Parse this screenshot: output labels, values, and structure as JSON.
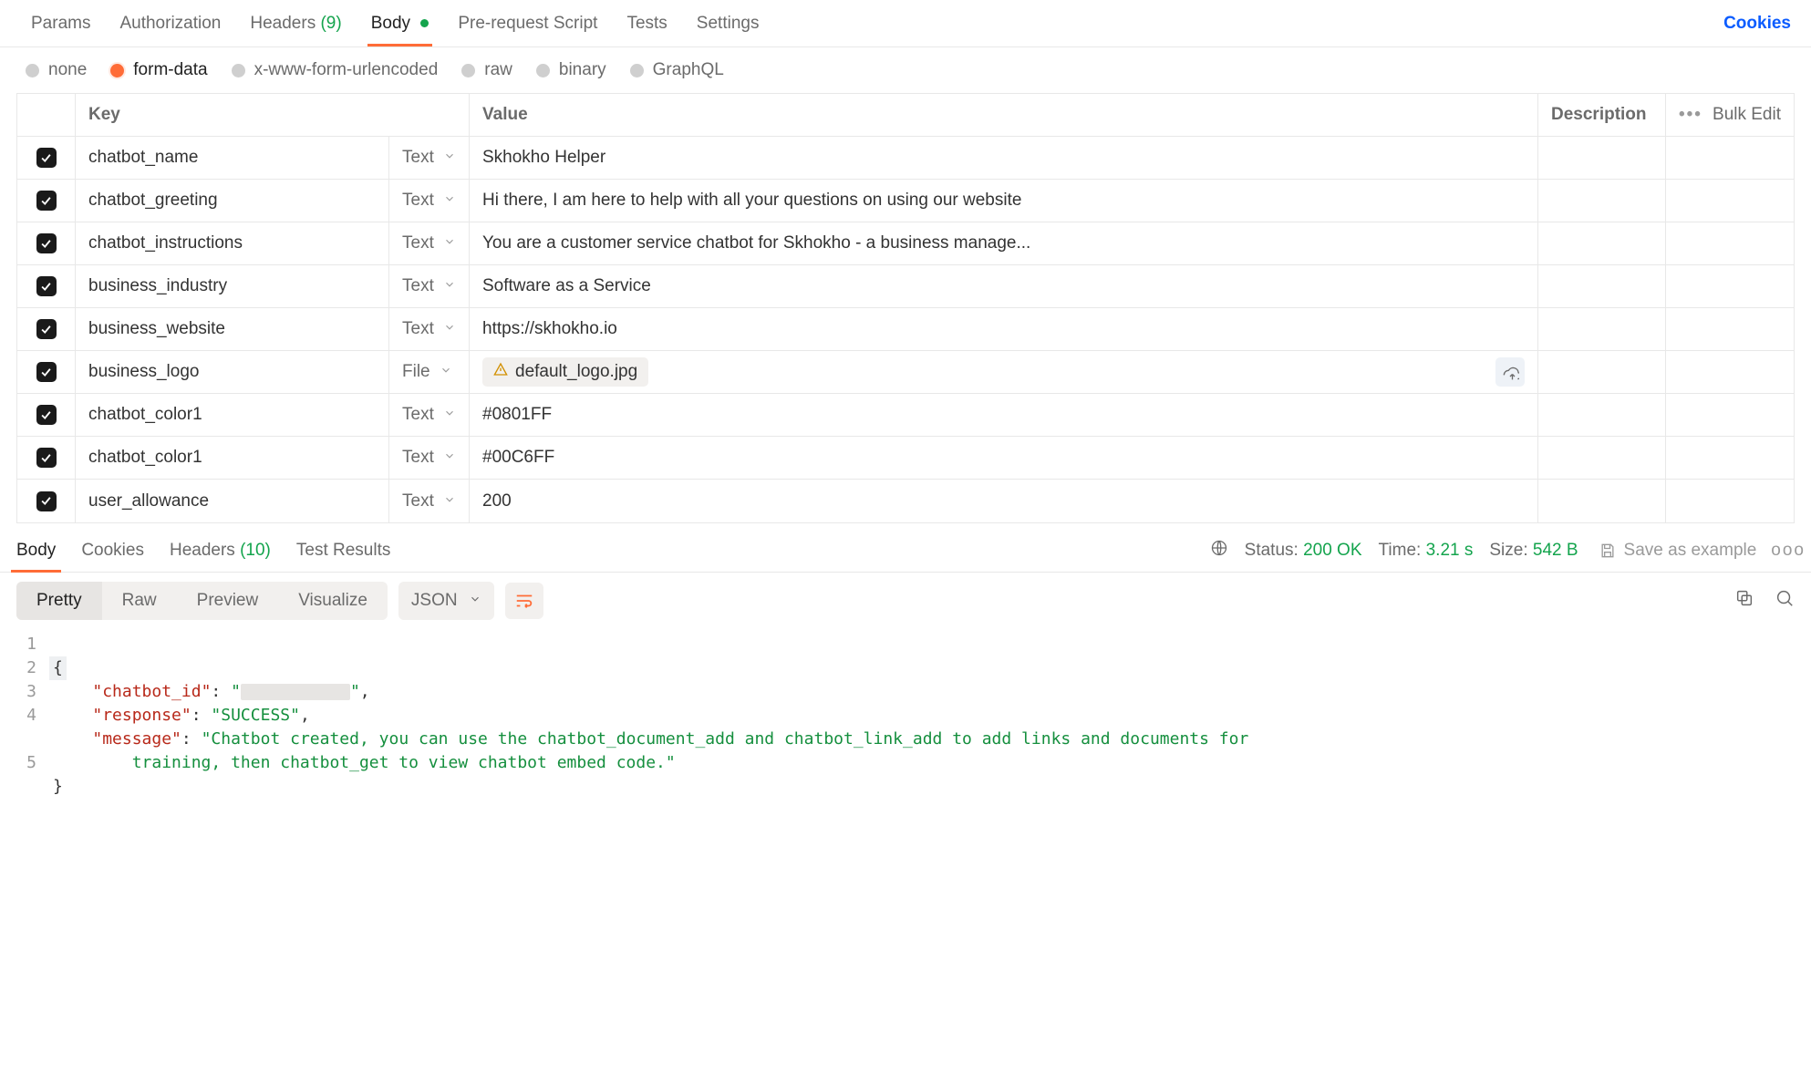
{
  "tabs": {
    "params": "Params",
    "authorization": "Authorization",
    "headers_label": "Headers",
    "headers_count": "(9)",
    "body": "Body",
    "prerequest": "Pre-request Script",
    "tests": "Tests",
    "settings": "Settings",
    "cookies": "Cookies"
  },
  "body_types": {
    "none": "none",
    "formdata": "form-data",
    "urlencoded": "x-www-form-urlencoded",
    "raw": "raw",
    "binary": "binary",
    "graphql": "GraphQL"
  },
  "table": {
    "header_key": "Key",
    "header_value": "Value",
    "header_description": "Description",
    "bulk_edit": "Bulk Edit",
    "more": "•••",
    "rows": [
      {
        "key": "chatbot_name",
        "type": "Text",
        "value": "Skhokho Helper"
      },
      {
        "key": "chatbot_greeting",
        "type": "Text",
        "value": "Hi there, I am here to help with all your questions on using our website"
      },
      {
        "key": "chatbot_instructions",
        "type": "Text",
        "value": "You are a customer service chatbot for Skhokho - a business manage..."
      },
      {
        "key": "business_industry",
        "type": "Text",
        "value": "Software as a Service"
      },
      {
        "key": "business_website",
        "type": "Text",
        "value": "https://skhokho.io"
      },
      {
        "key": "business_logo",
        "type": "File",
        "file": "default_logo.jpg"
      },
      {
        "key": "chatbot_color1",
        "type": "Text",
        "value": "#0801FF"
      },
      {
        "key": "chatbot_color1",
        "type": "Text",
        "value": "#00C6FF"
      },
      {
        "key": "user_allowance",
        "type": "Text",
        "value": "200"
      }
    ]
  },
  "response_tabs": {
    "body": "Body",
    "cookies": "Cookies",
    "headers_label": "Headers",
    "headers_count": "(10)",
    "test_results": "Test Results"
  },
  "response_meta": {
    "status_label": "Status:",
    "status_value": "200 OK",
    "time_label": "Time:",
    "time_value": "3.21 s",
    "size_label": "Size:",
    "size_value": "542 B",
    "save_as": "Save as example"
  },
  "view": {
    "pretty": "Pretty",
    "raw": "Raw",
    "preview": "Preview",
    "visualize": "Visualize",
    "format": "JSON"
  },
  "code": {
    "l1": "{",
    "k_chatbot_id": "\"chatbot_id\"",
    "k_response": "\"response\"",
    "v_response": "\"SUCCESS\"",
    "k_message": "\"message\"",
    "v_message_a": "\"Chatbot created, you can use the chatbot_document_add and chatbot_link_add to add links and documents for",
    "v_message_b": "training, then chatbot_get to view chatbot embed code.\"",
    "l5": "}",
    "g1": "1",
    "g2": "2",
    "g3": "3",
    "g4": "4",
    "g5": "5"
  }
}
